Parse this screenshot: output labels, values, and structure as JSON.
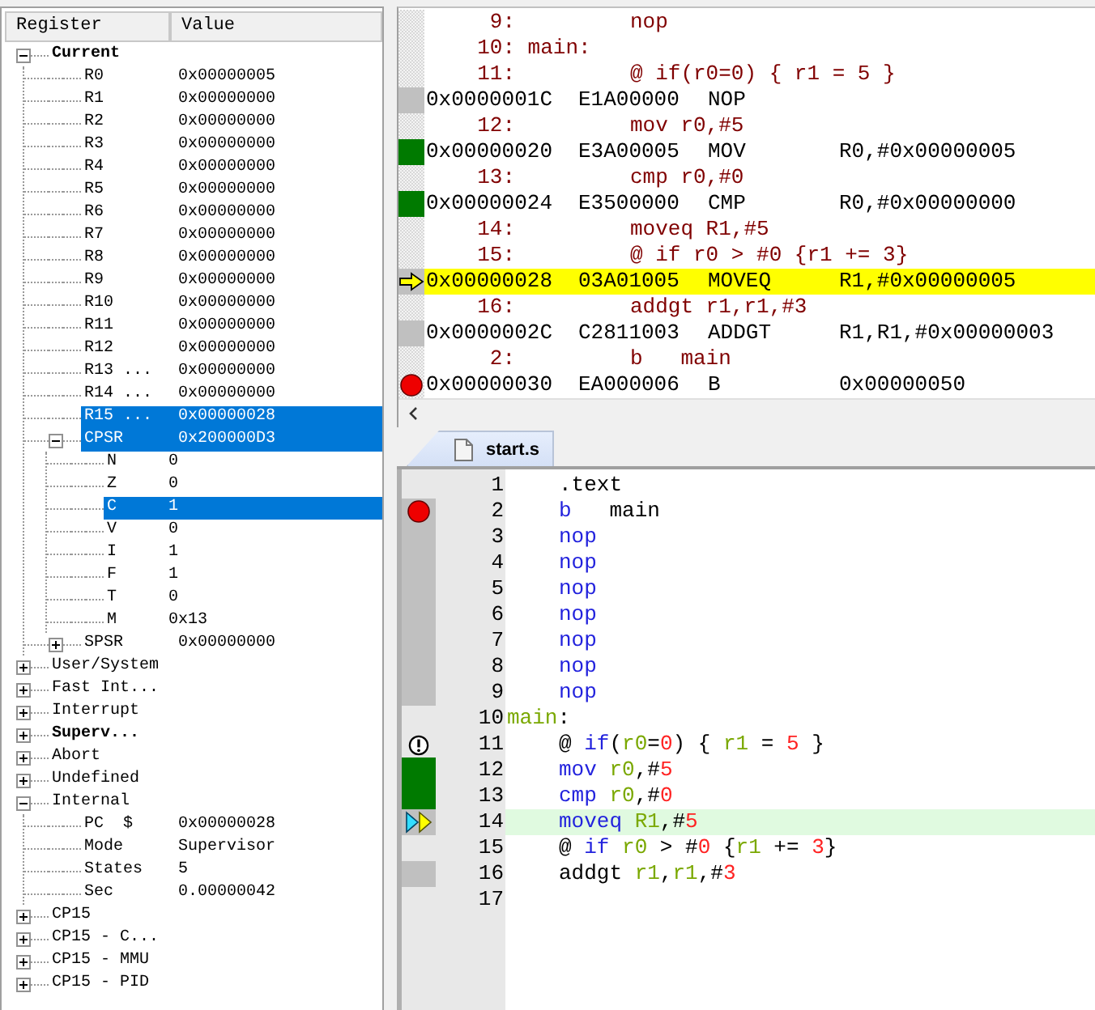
{
  "registers": {
    "columns": [
      "Register",
      "Value"
    ],
    "items": [
      {
        "name": "Current",
        "bold": true,
        "expanded": true,
        "selected": false,
        "children": [
          {
            "name": "R0",
            "value": "0x00000005",
            "selected": false
          },
          {
            "name": "R1",
            "value": "0x00000000",
            "selected": false
          },
          {
            "name": "R2",
            "value": "0x00000000",
            "selected": false
          },
          {
            "name": "R3",
            "value": "0x00000000",
            "selected": false
          },
          {
            "name": "R4",
            "value": "0x00000000",
            "selected": false
          },
          {
            "name": "R5",
            "value": "0x00000000",
            "selected": false
          },
          {
            "name": "R6",
            "value": "0x00000000",
            "selected": false
          },
          {
            "name": "R7",
            "value": "0x00000000",
            "selected": false
          },
          {
            "name": "R8",
            "value": "0x00000000",
            "selected": false
          },
          {
            "name": "R9",
            "value": "0x00000000",
            "selected": false
          },
          {
            "name": "R10",
            "value": "0x00000000",
            "selected": false
          },
          {
            "name": "R11",
            "value": "0x00000000",
            "selected": false
          },
          {
            "name": "R12",
            "value": "0x00000000",
            "selected": false
          },
          {
            "name": "R13 ...",
            "value": "0x00000000",
            "selected": false
          },
          {
            "name": "R14 ...",
            "value": "0x00000000",
            "selected": false
          },
          {
            "name": "R15 ...",
            "value": "0x00000028",
            "selected": true
          },
          {
            "name": "CPSR",
            "value": "0x200000D3",
            "selected": true,
            "expanded": true,
            "children": [
              {
                "name": "N",
                "value": "0",
                "selected": false
              },
              {
                "name": "Z",
                "value": "0",
                "selected": false
              },
              {
                "name": "C",
                "value": "1",
                "selected": true
              },
              {
                "name": "V",
                "value": "0",
                "selected": false
              },
              {
                "name": "I",
                "value": "1",
                "selected": false
              },
              {
                "name": "F",
                "value": "1",
                "selected": false
              },
              {
                "name": "T",
                "value": "0",
                "selected": false
              },
              {
                "name": "M",
                "value": "0x13",
                "selected": false
              }
            ]
          },
          {
            "name": "SPSR",
            "value": "0x00000000",
            "selected": false,
            "expanded": false
          }
        ]
      },
      {
        "name": "User/System",
        "expanded": false,
        "selected": false
      },
      {
        "name": "Fast Int...",
        "expanded": false,
        "selected": false
      },
      {
        "name": "Interrupt",
        "expanded": false,
        "selected": false
      },
      {
        "name": "Superv...",
        "bold": true,
        "expanded": false,
        "selected": false
      },
      {
        "name": "Abort",
        "expanded": false,
        "selected": false
      },
      {
        "name": "Undefined",
        "expanded": false,
        "selected": false
      },
      {
        "name": "Internal",
        "expanded": true,
        "selected": false,
        "children": [
          {
            "name": "PC  $",
            "value": "0x00000028",
            "selected": false
          },
          {
            "name": "Mode",
            "value": "Supervisor",
            "selected": false
          },
          {
            "name": "States",
            "value": "5",
            "selected": false
          },
          {
            "name": "Sec",
            "value": "0.00000042",
            "selected": false
          }
        ]
      },
      {
        "name": "CP15",
        "expanded": false,
        "selected": false
      },
      {
        "name": "CP15 - C...",
        "expanded": false,
        "selected": false
      },
      {
        "name": "CP15 - MMU",
        "expanded": false,
        "selected": false
      },
      {
        "name": "CP15 - PID",
        "expanded": false,
        "selected": false
      }
    ]
  },
  "disassembly": [
    {
      "kind": "source",
      "number": "9:",
      "code": "nop"
    },
    {
      "kind": "label",
      "number": "10:",
      "code": "main:"
    },
    {
      "kind": "source",
      "number": "11:",
      "code": "@ if(r0=0) { r1 = 5 }"
    },
    {
      "kind": "instruction",
      "address": "0x0000001C",
      "opcode": "E1A00000",
      "mnemonic": "NOP",
      "gutter": {
        "kind": "executed"
      },
      "current": false
    },
    {
      "kind": "source",
      "number": "12:",
      "code": "mov r0,#5"
    },
    {
      "kind": "instruction",
      "address": "0x00000020",
      "opcode": "E3A00005",
      "mnemonic": "MOV",
      "operands": "R0,#0x00000005",
      "gutter": {
        "kind": "covered"
      },
      "current": false
    },
    {
      "kind": "source",
      "number": "13:",
      "code": "cmp r0,#0"
    },
    {
      "kind": "instruction",
      "address": "0x00000024",
      "opcode": "E3500000",
      "mnemonic": "CMP",
      "operands": "R0,#0x00000000",
      "gutter": {
        "kind": "covered"
      },
      "current": false
    },
    {
      "kind": "source",
      "number": "14:",
      "code": "moveq R1,#5"
    },
    {
      "kind": "source",
      "number": "15:",
      "code": "@ if r0 > #0 {r1 += 3}"
    },
    {
      "kind": "instruction",
      "address": "0x00000028",
      "opcode": "03A01005",
      "mnemonic": "MOVEQ",
      "operands": "R1,#0x00000005",
      "gutter": {
        "kind": "current"
      },
      "current": true
    },
    {
      "kind": "source",
      "number": "16:",
      "code": "addgt r1,r1,#3"
    },
    {
      "kind": "instruction",
      "address": "0x0000002C",
      "opcode": "C2811003",
      "mnemonic": "ADDGT",
      "operands": "R1,R1,#0x00000003",
      "gutter": {
        "kind": "executed"
      },
      "current": false
    },
    {
      "kind": "source",
      "number": "2:",
      "code": "b   main"
    },
    {
      "kind": "instruction",
      "address": "0x00000030",
      "opcode": "EA000006",
      "mnemonic": "B",
      "operands": "0x00000050",
      "gutter": {
        "kind": "breakpoint"
      },
      "current": false
    }
  ],
  "editor": {
    "tabs": [
      {
        "label": "start.s",
        "selected": true
      }
    ],
    "lines": [
      {
        "number": "1",
        "indented": true,
        "current": false,
        "tokens": [
          {
            "text": ".text",
            "kind": "plain"
          }
        ]
      },
      {
        "number": "2",
        "indented": true,
        "current": false,
        "gutter": {
          "kind": "breakpoint"
        },
        "tokens": [
          {
            "text": "b",
            "kind": "op"
          },
          {
            "text": "   main",
            "kind": "plain"
          }
        ]
      },
      {
        "number": "3",
        "indented": true,
        "current": false,
        "gutter": {
          "kind": "executed"
        },
        "tokens": [
          {
            "text": "nop",
            "kind": "op"
          }
        ]
      },
      {
        "number": "4",
        "indented": true,
        "current": false,
        "gutter": {
          "kind": "executed"
        },
        "tokens": [
          {
            "text": "nop",
            "kind": "op"
          }
        ]
      },
      {
        "number": "5",
        "indented": true,
        "current": false,
        "gutter": {
          "kind": "executed"
        },
        "tokens": [
          {
            "text": "nop",
            "kind": "op"
          }
        ]
      },
      {
        "number": "6",
        "indented": true,
        "current": false,
        "gutter": {
          "kind": "executed"
        },
        "tokens": [
          {
            "text": "nop",
            "kind": "op"
          }
        ]
      },
      {
        "number": "7",
        "indented": true,
        "current": false,
        "gutter": {
          "kind": "executed"
        },
        "tokens": [
          {
            "text": "nop",
            "kind": "op"
          }
        ]
      },
      {
        "number": "8",
        "indented": true,
        "current": false,
        "gutter": {
          "kind": "executed"
        },
        "tokens": [
          {
            "text": "nop",
            "kind": "op"
          }
        ]
      },
      {
        "number": "9",
        "indented": true,
        "current": false,
        "gutter": {
          "kind": "executed"
        },
        "tokens": [
          {
            "text": "nop",
            "kind": "op"
          }
        ]
      },
      {
        "number": "10",
        "indented": false,
        "current": false,
        "tokens": [
          {
            "text": "main",
            "kind": "label"
          },
          {
            "text": ":",
            "kind": "plain"
          }
        ]
      },
      {
        "number": "11",
        "indented": true,
        "current": false,
        "gutter": {
          "kind": "warning"
        },
        "tokens": [
          {
            "text": "@ ",
            "kind": "plain"
          },
          {
            "text": "if",
            "kind": "op"
          },
          {
            "text": "(",
            "kind": "plain"
          },
          {
            "text": "r0",
            "kind": "reg"
          },
          {
            "text": "=",
            "kind": "plain"
          },
          {
            "text": "0",
            "kind": "num"
          },
          {
            "text": ") { ",
            "kind": "plain"
          },
          {
            "text": "r1",
            "kind": "reg"
          },
          {
            "text": " = ",
            "kind": "plain"
          },
          {
            "text": "5",
            "kind": "num"
          },
          {
            "text": " }",
            "kind": "plain"
          }
        ]
      },
      {
        "number": "12",
        "indented": true,
        "current": false,
        "gutter": {
          "kind": "covered"
        },
        "tokens": [
          {
            "text": "mov ",
            "kind": "op"
          },
          {
            "text": "r0",
            "kind": "reg"
          },
          {
            "text": ",#",
            "kind": "plain"
          },
          {
            "text": "5",
            "kind": "num"
          }
        ]
      },
      {
        "number": "13",
        "indented": true,
        "current": false,
        "gutter": {
          "kind": "covered"
        },
        "tokens": [
          {
            "text": "cmp ",
            "kind": "op"
          },
          {
            "text": "r0",
            "kind": "reg"
          },
          {
            "text": ",#",
            "kind": "plain"
          },
          {
            "text": "0",
            "kind": "num"
          }
        ]
      },
      {
        "number": "14",
        "indented": true,
        "current": true,
        "gutter": {
          "kind": "current"
        },
        "tokens": [
          {
            "text": "moveq ",
            "kind": "op"
          },
          {
            "text": "R1",
            "kind": "reg"
          },
          {
            "text": ",#",
            "kind": "plain"
          },
          {
            "text": "5",
            "kind": "num"
          }
        ]
      },
      {
        "number": "15",
        "indented": true,
        "current": false,
        "tokens": [
          {
            "text": "@ ",
            "kind": "plain"
          },
          {
            "text": "if ",
            "kind": "op"
          },
          {
            "text": "r0",
            "kind": "reg"
          },
          {
            "text": " > #",
            "kind": "plain"
          },
          {
            "text": "0",
            "kind": "num"
          },
          {
            "text": " {",
            "kind": "plain"
          },
          {
            "text": "r1",
            "kind": "reg"
          },
          {
            "text": " += ",
            "kind": "plain"
          },
          {
            "text": "3",
            "kind": "num"
          },
          {
            "text": "}",
            "kind": "plain"
          }
        ]
      },
      {
        "number": "16",
        "indented": true,
        "current": false,
        "gutter": {
          "kind": "executed"
        },
        "tokens": [
          {
            "text": "addgt ",
            "kind": "plain"
          },
          {
            "text": "r1",
            "kind": "reg"
          },
          {
            "text": ",",
            "kind": "plain"
          },
          {
            "text": "r1",
            "kind": "reg"
          },
          {
            "text": ",#",
            "kind": "plain"
          },
          {
            "text": "3",
            "kind": "num"
          }
        ]
      },
      {
        "number": "17"
      }
    ]
  }
}
